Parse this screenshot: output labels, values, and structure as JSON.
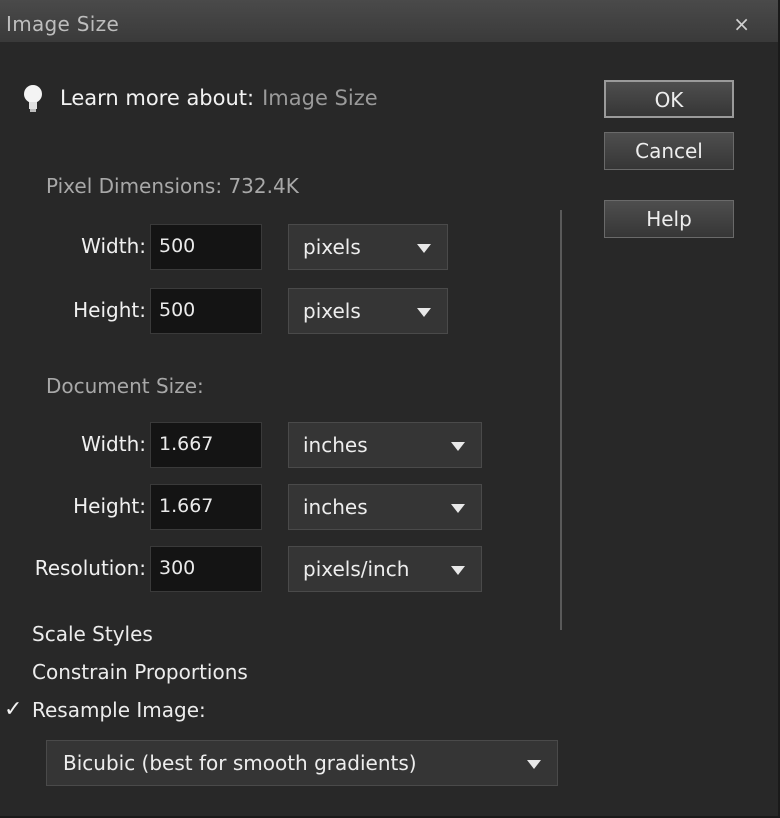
{
  "dialog": {
    "title": "Image Size",
    "close_glyph": "×",
    "learn_prefix": "Learn more about:",
    "learn_link": "Image Size"
  },
  "buttons": {
    "ok": "OK",
    "cancel": "Cancel",
    "help": "Help"
  },
  "pixel_dimensions": {
    "heading": "Pixel Dimensions: 732.4K",
    "width_label": "Width:",
    "width_value": "500",
    "width_unit": "pixels",
    "height_label": "Height:",
    "height_value": "500",
    "height_unit": "pixels"
  },
  "document_size": {
    "heading": "Document Size:",
    "width_label": "Width:",
    "width_value": "1.667",
    "width_unit": "inches",
    "height_label": "Height:",
    "height_value": "1.667",
    "height_unit": "inches",
    "resolution_label": "Resolution:",
    "resolution_value": "300",
    "resolution_unit": "pixels/inch"
  },
  "options": {
    "scale_styles": "Scale Styles",
    "constrain_proportions": "Constrain Proportions",
    "resample_image": "Resample Image:",
    "resample_checked": true,
    "resample_method": "Bicubic (best for smooth gradients)"
  },
  "icons": {
    "learn": "lightbulb-icon",
    "close": "close-icon",
    "checkmark": "checkmark-icon",
    "dropdown": "chevron-down-icon"
  }
}
